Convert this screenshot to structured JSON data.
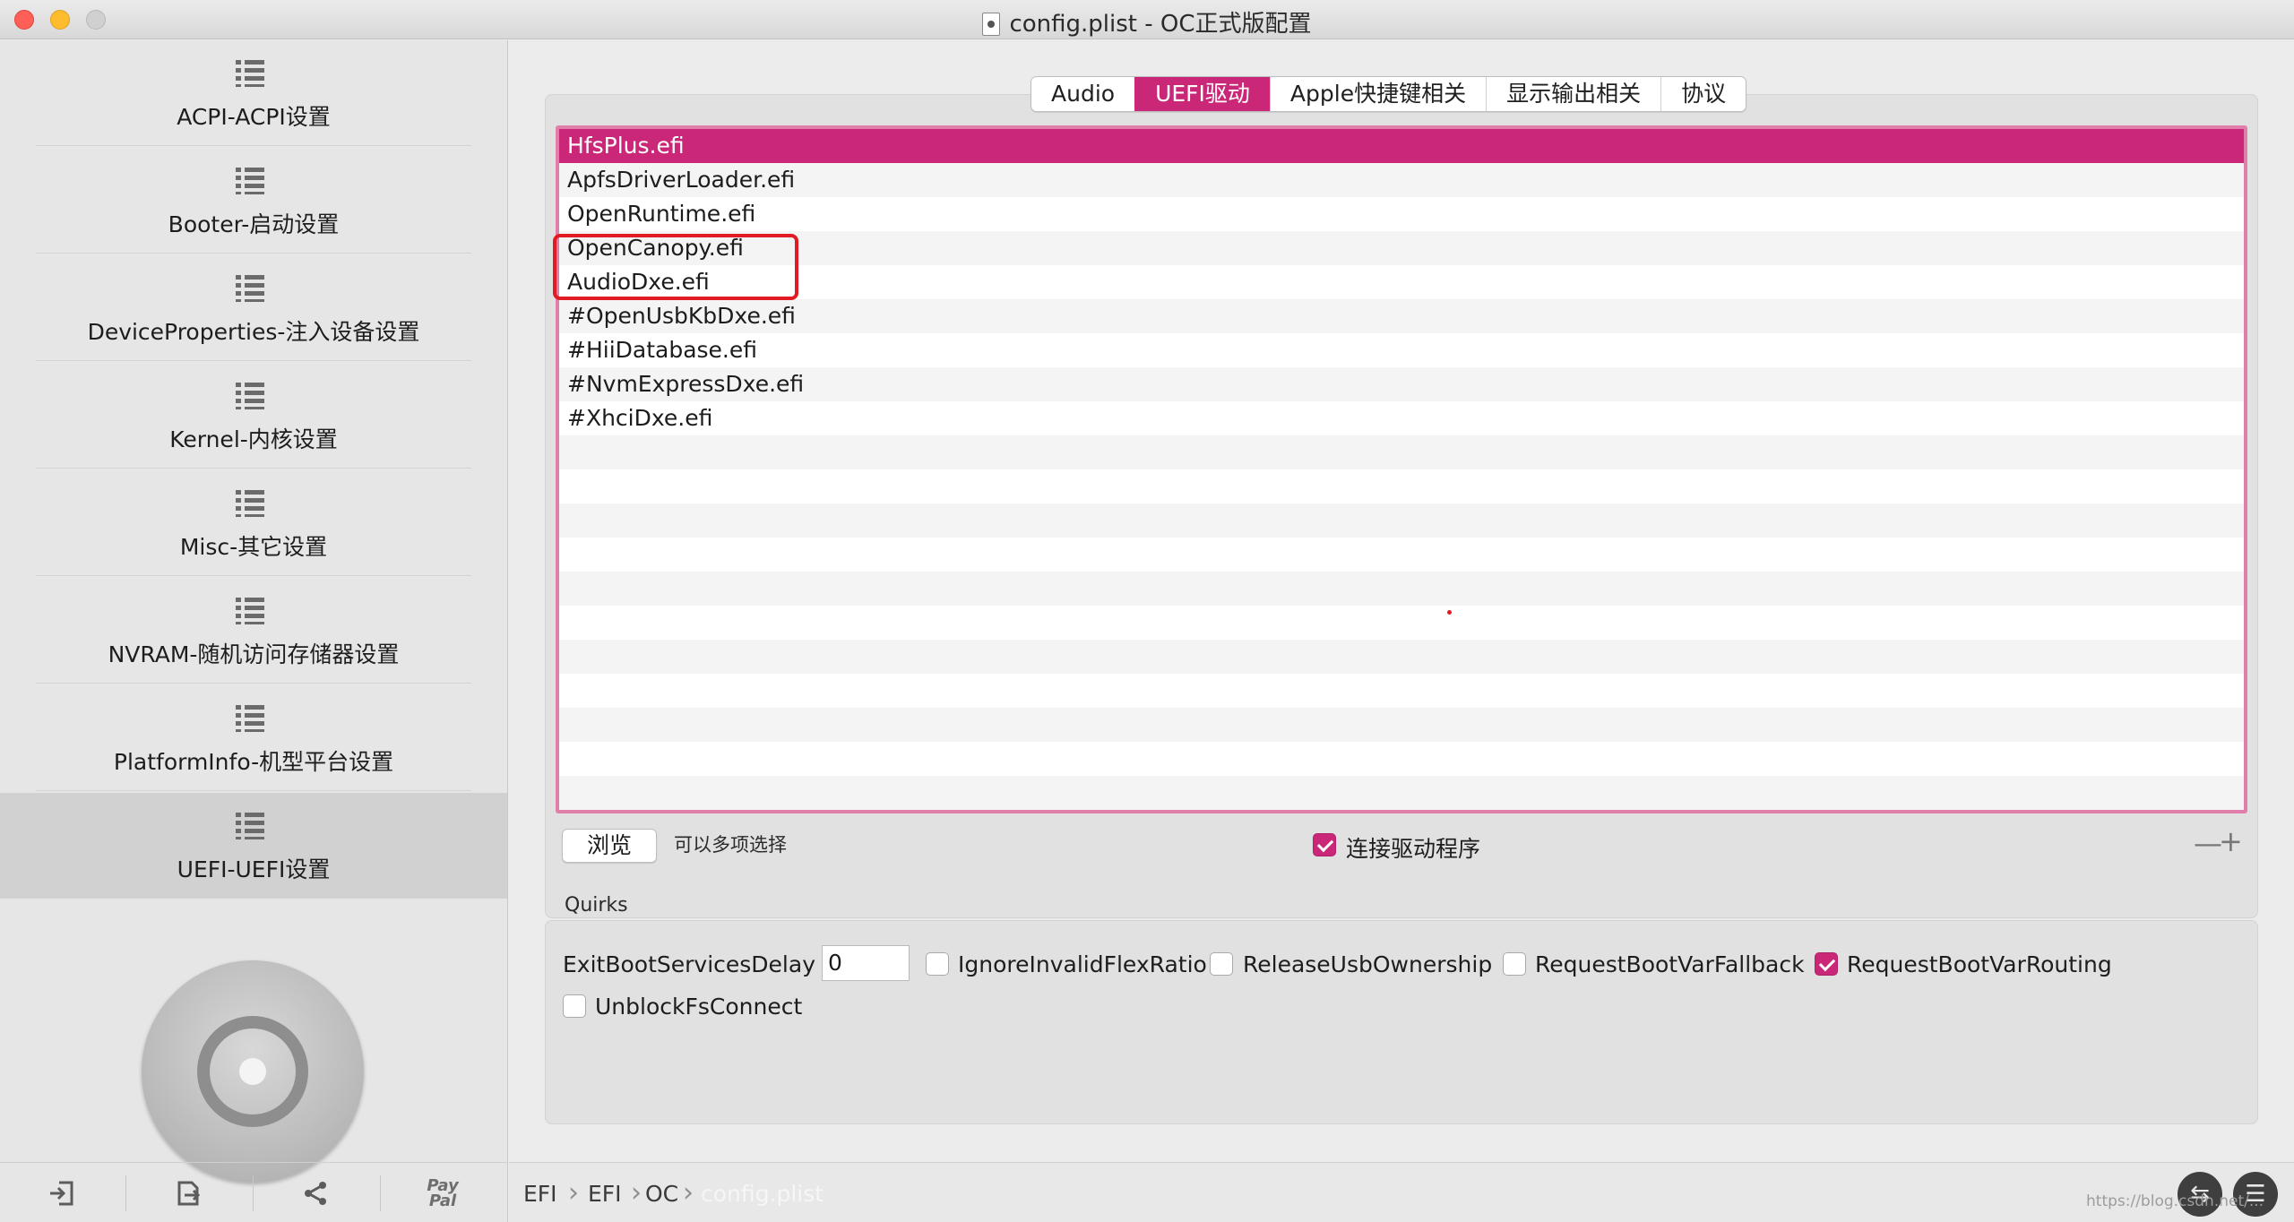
{
  "window": {
    "title": "config.plist - OC正式版配置"
  },
  "sidebar": {
    "items": [
      {
        "label": "ACPI-ACPI设置",
        "icon": "list-icon"
      },
      {
        "label": "Booter-启动设置",
        "icon": "list-icon"
      },
      {
        "label": "DeviceProperties-注入设备设置",
        "icon": "list-icon"
      },
      {
        "label": "Kernel-内核设置",
        "icon": "list-icon"
      },
      {
        "label": "Misc-其它设置",
        "icon": "list-icon"
      },
      {
        "label": "NVRAM-随机访问存储器设置",
        "icon": "list-icon"
      },
      {
        "label": "PlatformInfo-机型平台设置",
        "icon": "list-icon"
      },
      {
        "label": "UEFI-UEFI设置",
        "icon": "list-icon",
        "active": true
      }
    ],
    "footer": {
      "buttons": [
        "import-icon",
        "export-icon",
        "share-icon",
        "paypal-icon"
      ],
      "paypal_text": "Pay Pal"
    }
  },
  "tabs": [
    {
      "label": "Audio"
    },
    {
      "label": "UEFI驱动",
      "active": true
    },
    {
      "label": "Apple快捷键相关"
    },
    {
      "label": "显示输出相关"
    },
    {
      "label": "协议"
    }
  ],
  "drivers": {
    "rows": [
      "HfsPlus.efi",
      "ApfsDriverLoader.efi",
      "OpenRuntime.efi",
      "OpenCanopy.efi",
      "AudioDxe.efi",
      "#OpenUsbKbDxe.efi",
      "#HiiDatabase.efi",
      "#NvmExpressDxe.efi",
      "#XhciDxe.efi"
    ],
    "selected_index": 0,
    "browse_button": "浏览",
    "multi_select_hint": "可以多项选择",
    "connect_drivers_label": "连接驱动程序",
    "connect_drivers_checked": true,
    "remove_symbol": "—",
    "add_symbol": "+"
  },
  "quirks": {
    "title": "Quirks",
    "exit_boot_services_delay_label": "ExitBootServicesDelay",
    "exit_boot_services_delay_value": "0",
    "options": [
      {
        "label": "IgnoreInvalidFlexRatio",
        "checked": false
      },
      {
        "label": "ReleaseUsbOwnership",
        "checked": false
      },
      {
        "label": "RequestBootVarFallback",
        "checked": false
      },
      {
        "label": "RequestBootVarRouting",
        "checked": true
      },
      {
        "label": "UnblockFsConnect",
        "checked": false
      }
    ]
  },
  "pathbar": {
    "crumbs": [
      "EFI",
      "EFI",
      "OC",
      "config.plist"
    ]
  },
  "watermark": "https://blog.csdn.net/...",
  "colors": {
    "accent": "#cb2778",
    "highlight_box": "#e01b24"
  }
}
